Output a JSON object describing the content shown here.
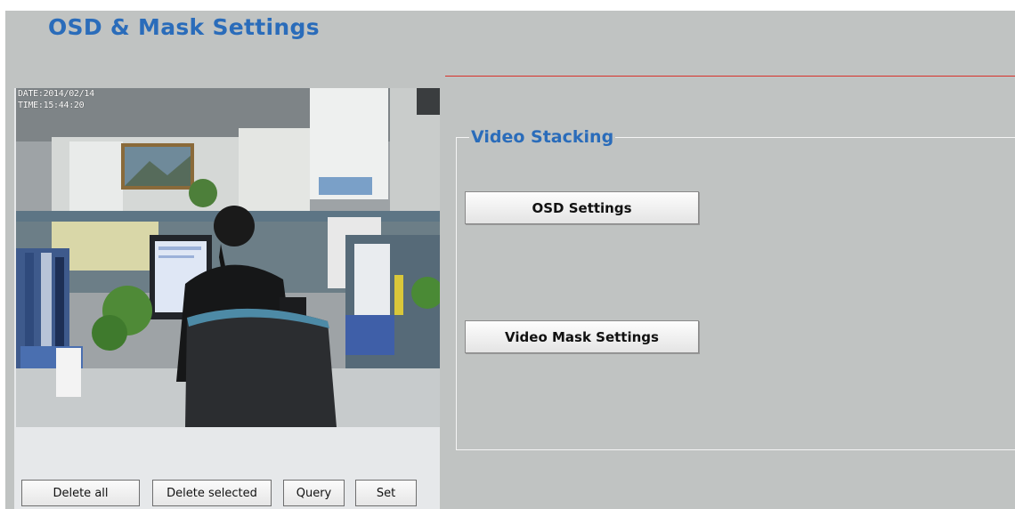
{
  "page": {
    "title": "OSD & Mask Settings"
  },
  "preview": {
    "osd_date": "DATE:2014/02/14",
    "osd_time": "TIME:15:44:20"
  },
  "buttons": {
    "delete_all": "Delete all",
    "delete_selected": "Delete selected",
    "query": "Query",
    "set": "Set"
  },
  "video_stacking": {
    "title": "Video Stacking",
    "osd_settings": "OSD Settings",
    "video_mask_settings": "Video Mask Settings"
  },
  "colors": {
    "title_blue": "#2a6cba",
    "divider_red": "#d8322a",
    "page_gray": "#c0c3c2"
  }
}
